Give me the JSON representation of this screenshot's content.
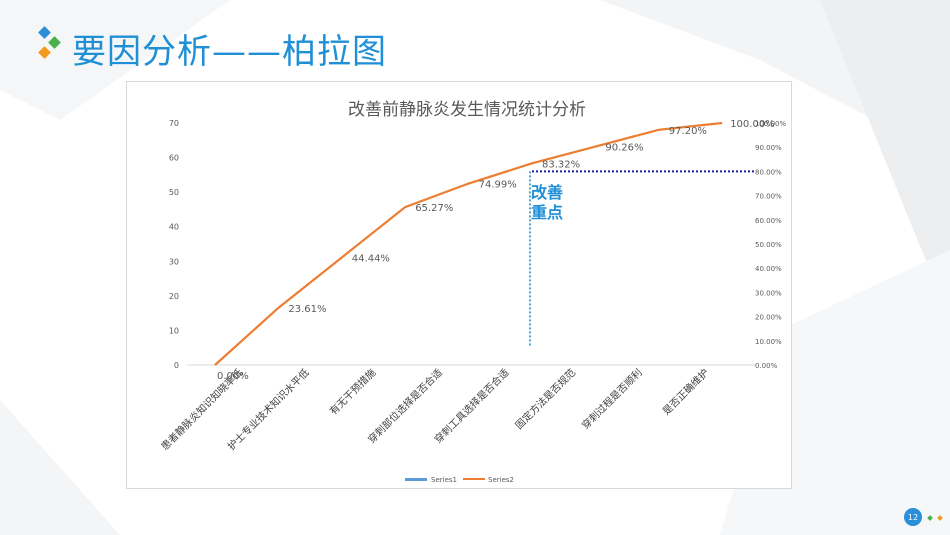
{
  "slide": {
    "title": "要因分析——柏拉图",
    "page_number": "12",
    "accent_color": "#1f8fd6"
  },
  "chart_data": {
    "type": "line",
    "title": "改善前静脉炎发生情况统计分析",
    "categories": [
      "患者静脉炎知识知晓率低",
      "护士专业技术知识水平低",
      "有无干预措施",
      "穿刺部位选择是否合适",
      "穿刺工具选择是否合适",
      "固定方法是否规范",
      "穿刺过程是否顺利",
      "是否正确维护"
    ],
    "series": [
      {
        "name": "Series1",
        "axis": "left",
        "type": "bar",
        "color": "#5b9bd5",
        "values": []
      },
      {
        "name": "Series2",
        "axis": "right",
        "type": "line",
        "color": "#ed7d31",
        "values": [
          0.0,
          23.61,
          44.44,
          65.27,
          74.99,
          83.32,
          90.26,
          97.2,
          100.0
        ],
        "labels": [
          "0.00%",
          "23.61%",
          "44.44%",
          "65.27%",
          "74.99%",
          "83.32%",
          "90.26%",
          "97.20%",
          "100.00%"
        ]
      }
    ],
    "ylim_left": [
      0,
      70
    ],
    "yticks_left": [
      "0",
      "10",
      "20",
      "30",
      "40",
      "50",
      "60",
      "70"
    ],
    "ylim_right": [
      0,
      100
    ],
    "yticks_right": [
      "0.00%",
      "10.00%",
      "20.00%",
      "30.00%",
      "40.00%",
      "50.00%",
      "60.00%",
      "70.00%",
      "80.00%",
      "90.00%",
      "100.00%"
    ],
    "grid": false,
    "legend": "bottom",
    "threshold": {
      "value": 80,
      "axis": "right",
      "color": "#1f1f9e"
    },
    "marker_x": 5,
    "marker_color": "#4aa3c8",
    "annotation": {
      "lines": [
        "改善",
        "重点"
      ],
      "color": "#1f8fd6"
    }
  }
}
